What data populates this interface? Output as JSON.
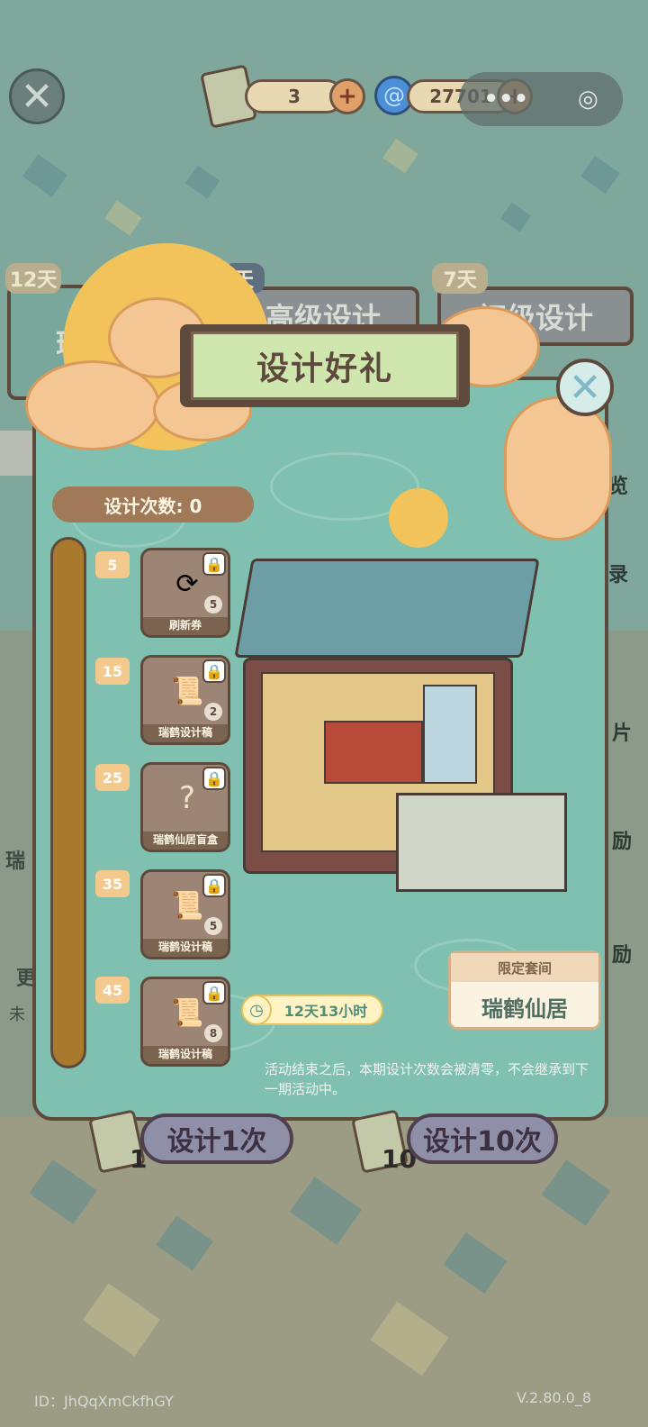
{
  "hud": {
    "close_glyph": "✕",
    "scroll_count": "3",
    "coin_count": "27701",
    "capsule_menu": "•••",
    "capsule_target": "◎",
    "plus_glyph": "+"
  },
  "behind_tabs": {
    "tab1_day": "12天",
    "tab1_label": "瑞",
    "tab2_day": "天",
    "tab2_label": "高级设计",
    "tab3_day": "7天",
    "tab3_label": "初级设计"
  },
  "modal": {
    "title": "设计好礼",
    "close_glyph": "✕",
    "design_count": "设计次数: 0",
    "milestones": [
      "5",
      "15",
      "25",
      "35",
      "45"
    ],
    "rewards": [
      {
        "label": "刷新券",
        "qty": "5",
        "icon": "refresh-ticket-icon"
      },
      {
        "label": "瑞鹤设计稿",
        "qty": "2",
        "icon": "crane-scroll-icon"
      },
      {
        "label": "瑞鹤仙居盲盒",
        "qty": "",
        "icon": "mystery-box-icon"
      },
      {
        "label": "瑞鹤设计稿",
        "qty": "5",
        "icon": "crane-scroll-icon"
      },
      {
        "label": "瑞鹤设计稿",
        "qty": "8",
        "icon": "crane-scroll-icon"
      }
    ],
    "timer": "12天13小时",
    "notice": "活动结束之后，本期设计次数会被清零，不会继承到下一期活动中。",
    "limited_title": "限定套间",
    "limited_name": "瑞鹤仙居"
  },
  "side_partial": [
    "览",
    "录",
    "片",
    "励",
    "励"
  ],
  "left_partial": [
    "瑞",
    "更",
    "未"
  ],
  "bottom": {
    "design_once": "设计1次",
    "design_once_cost": "1",
    "design_ten": "设计10次",
    "design_ten_cost": "10"
  },
  "footer": {
    "id_text": "ID：JhQqXmCkfhGY",
    "version": "V.2.80.0_8"
  },
  "colors": {
    "modal_bg": "#7fc0b0",
    "border_brown": "#5d4a3c",
    "gold": "#f1c35a"
  }
}
